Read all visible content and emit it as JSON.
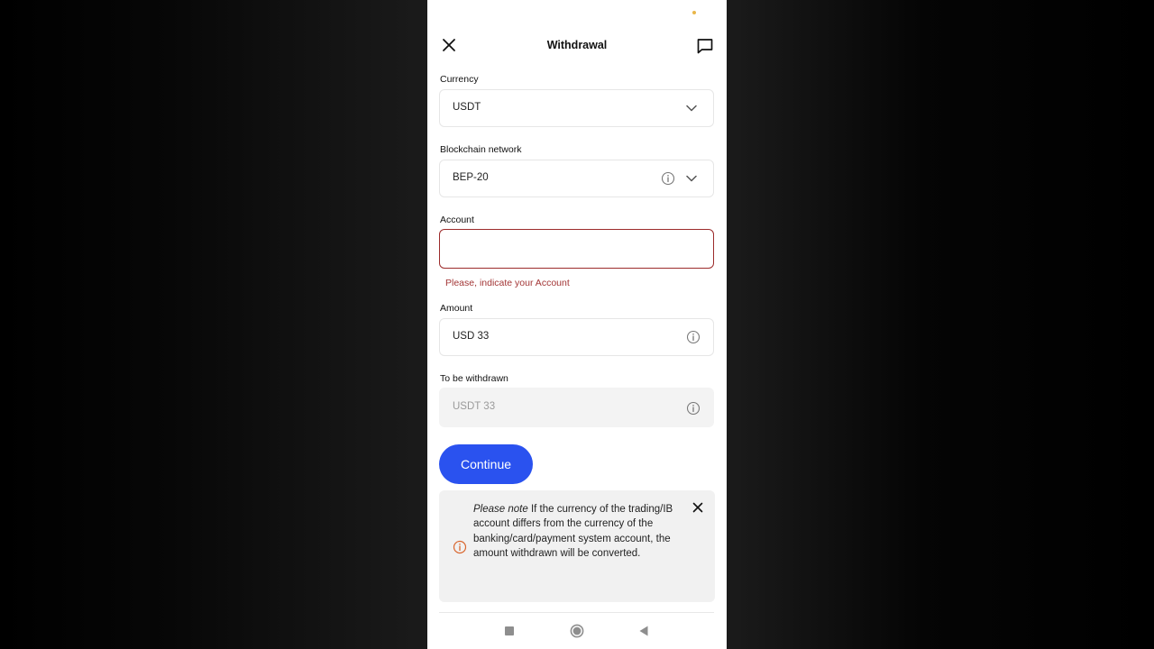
{
  "header": {
    "title": "Withdrawal"
  },
  "form": {
    "currency": {
      "label": "Currency",
      "value": "USDT"
    },
    "network": {
      "label": "Blockchain network",
      "value": "BEP-20"
    },
    "account": {
      "label": "Account",
      "value": "",
      "error": "Please, indicate your Account"
    },
    "amount": {
      "label": "Amount",
      "value": "USD 33"
    },
    "withdrawn": {
      "label": "To be withdrawn",
      "value": "USDT 33"
    }
  },
  "actions": {
    "continue_label": "Continue"
  },
  "note": {
    "lead": "Please note",
    "text": " If the currency of the trading/IB account differs from the currency of the banking/card/payment system account, the amount withdrawn will be converted."
  },
  "colors": {
    "accent": "#2a52ef",
    "error": "#a33636",
    "warning_icon": "#d9662e"
  },
  "icons": {
    "close": "close-icon",
    "chat": "chat-icon",
    "chevron": "chevron-down-icon",
    "info": "info-icon",
    "warning": "warning-info-icon"
  }
}
